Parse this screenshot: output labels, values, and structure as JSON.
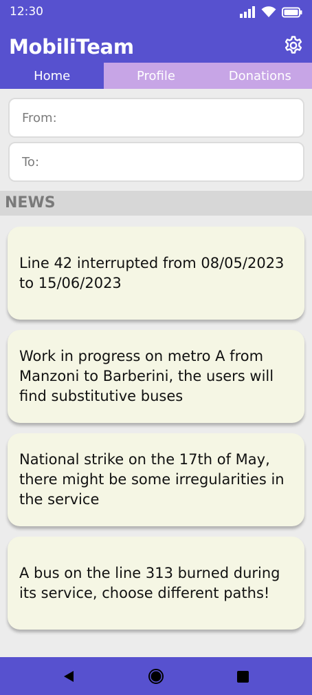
{
  "status": {
    "time": "12:30"
  },
  "app": {
    "title": "MobiliTeam",
    "brand_color": "#5751cf",
    "tab_inactive_color": "#c7a5e6",
    "card_color": "#f5f6e4"
  },
  "tabs": [
    {
      "label": "Home",
      "active": true
    },
    {
      "label": "Profile",
      "active": false
    },
    {
      "label": "Donations",
      "active": false
    }
  ],
  "search": {
    "from_placeholder": "From:",
    "to_placeholder": "To:"
  },
  "news": {
    "header": "NEWS",
    "items": [
      {
        "text": "Line 42 interrupted from 08/05/2023 to 15/06/2023"
      },
      {
        "text": "Work in progress on metro A from Manzoni to Barberini, the users will find substitutive buses"
      },
      {
        "text": "National strike on the 17th of May, there might be some irregularities in the service"
      },
      {
        "text": "A bus on the line 313 burned during its service, choose different paths!"
      }
    ]
  },
  "icons": {
    "settings": "gear-icon",
    "signal": "signal-icon",
    "wifi": "wifi-icon",
    "battery": "battery-icon",
    "back": "back-triangle-icon",
    "home": "home-circle-icon",
    "recents": "recents-square-icon"
  }
}
